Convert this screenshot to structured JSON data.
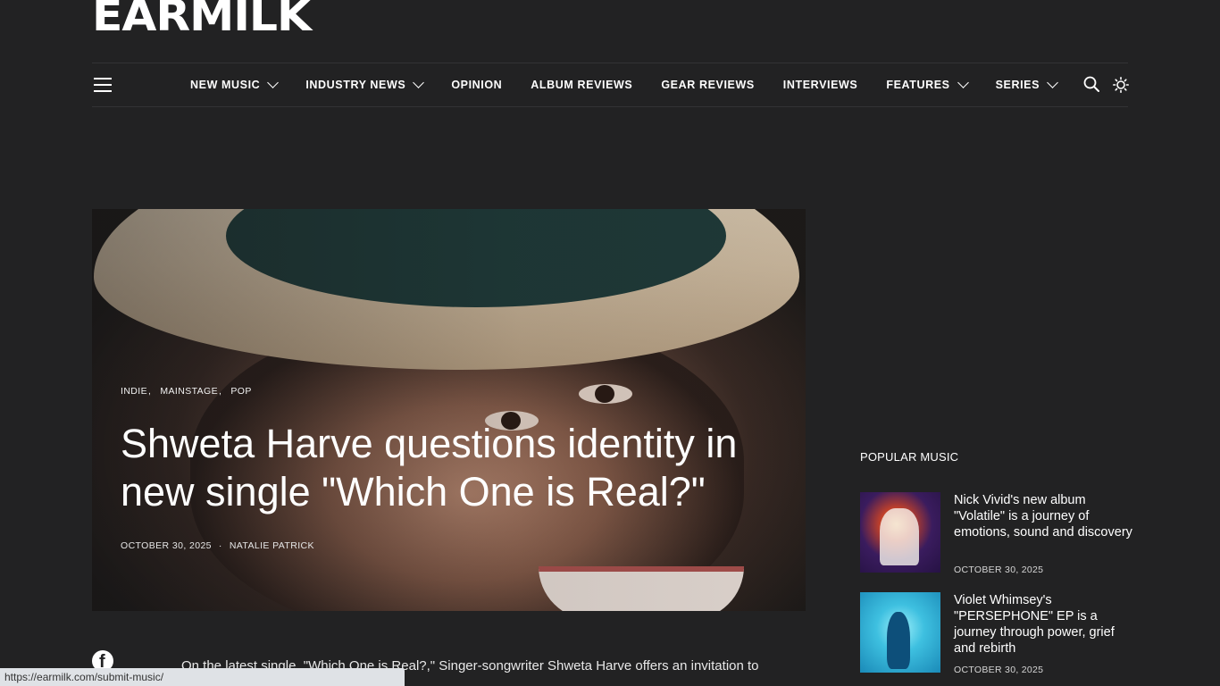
{
  "site": {
    "logo": "EARMILK"
  },
  "nav": {
    "items": [
      {
        "label": "NEW MUSIC",
        "dropdown": true
      },
      {
        "label": "INDUSTRY NEWS",
        "dropdown": true
      },
      {
        "label": "OPINION",
        "dropdown": false
      },
      {
        "label": "ALBUM REVIEWS",
        "dropdown": false
      },
      {
        "label": "GEAR REVIEWS",
        "dropdown": false
      },
      {
        "label": "INTERVIEWS",
        "dropdown": false
      },
      {
        "label": "FEATURES",
        "dropdown": true
      },
      {
        "label": "SERIES",
        "dropdown": true
      }
    ],
    "icons": [
      "hamburger-menu-icon",
      "search-icon",
      "sun-icon"
    ]
  },
  "article": {
    "categories": [
      "INDIE",
      "MAINSTAGE",
      "POP"
    ],
    "title": "Shweta Harve questions identity in new single \"Which One is Real?\"",
    "date": "OCTOBER 30, 2025",
    "author": "NATALIE PATRICK",
    "body_preview": "On the latest single, \"Which One is Real?,\" Singer-songwriter Shweta Harve offers an invitation to"
  },
  "sidebar": {
    "heading": "POPULAR MUSIC",
    "items": [
      {
        "title": "Nick Vivid's new album \"Volatile\" is a journey of emotions, sound and discovery",
        "date": "OCTOBER 30, 2025"
      },
      {
        "title": "Violet Whimsey's \"PERSEPHONE\" EP is a journey through power, grief and rebirth",
        "date": "OCTOBER 30, 2025"
      }
    ]
  },
  "status_bar": {
    "url": "https://earmilk.com/submit-music/"
  },
  "colors": {
    "background": "#222223",
    "text": "#ffffff"
  }
}
